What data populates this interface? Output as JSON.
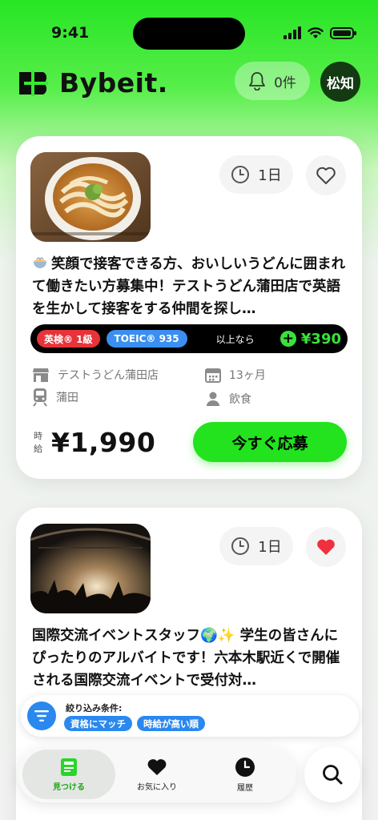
{
  "status_bar": {
    "time": "9:41"
  },
  "header": {
    "brand": "Bybeit.",
    "notification_count": "0件",
    "avatar_text": "松知"
  },
  "jobs": [
    {
      "thumbnail": "udon-bowl-photo",
      "days": "1日",
      "favorited": false,
      "title": "笑顔で接客できる方、おいしいうどんに囲まれて働きたい方募集中！テストうどん蒲田店で英語を生かして接客をする仲間を探し…",
      "eiken": "英検® 1級",
      "toeic": "TOEIC® 935",
      "condition_text": "以上なら",
      "bonus": "¥390",
      "store": "テストうどん蒲田店",
      "duration": "13ヶ月",
      "station": "蒲田",
      "category": "飲食",
      "wage_label": "時給",
      "wage": "¥1,990",
      "apply_label": "今すぐ応募"
    },
    {
      "thumbnail": "concert-crowd-photo",
      "days": "1日",
      "favorited": true,
      "title": "国際交流イベントスタッフ🌍✨ 学生の皆さんにぴったりのアルバイトです！六本木駅近くで開催される国際交流イベントで受付対…"
    }
  ],
  "filter": {
    "label": "絞り込み条件:",
    "chips": [
      "資格にマッチ",
      "時給が高い順"
    ]
  },
  "tabs": [
    {
      "label": "見つける",
      "icon": "find-icon",
      "active": true
    },
    {
      "label": "お気に入り",
      "icon": "heart-icon",
      "active": false
    },
    {
      "label": "履歴",
      "icon": "clock-icon",
      "active": false
    }
  ],
  "colors": {
    "brand_green": "#22e31e",
    "eiken_red": "#e8333a",
    "toeic_blue": "#3a8ff0",
    "filter_blue": "#2a88ee",
    "favorite_red": "#f0303f"
  }
}
